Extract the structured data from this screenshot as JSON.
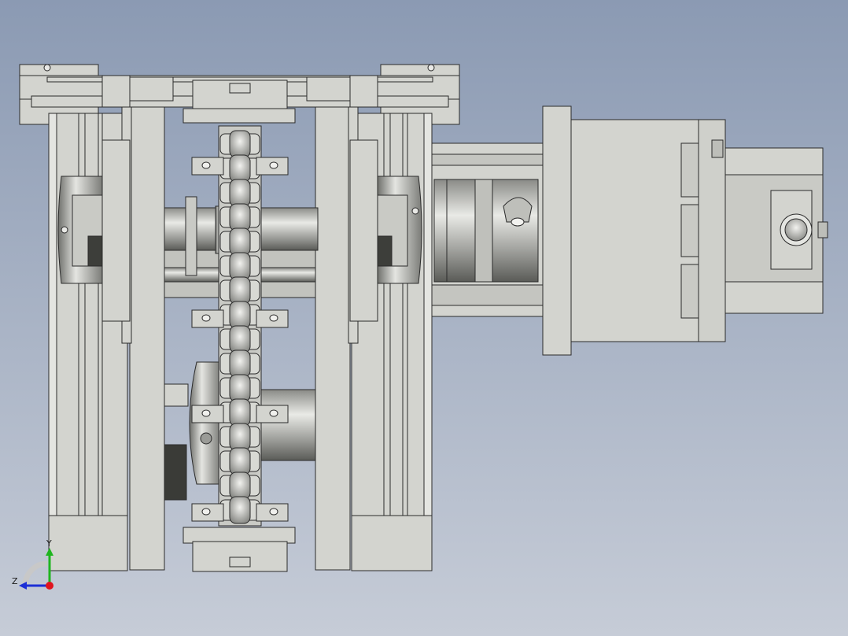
{
  "viewport": {
    "background_top": "#8b9ab3",
    "background_bottom": "#c6ccd7"
  },
  "model": {
    "part_fill": "#d3d4cf",
    "part_edge": "#2b2b2b",
    "shaded_dark": "#5f605c",
    "components": [
      "frame",
      "chain",
      "sprockets",
      "shaft",
      "coupling",
      "gearbox",
      "motor"
    ]
  },
  "triad": {
    "y_label": "Y",
    "z_label": "Z",
    "x_color": "#e0141e",
    "y_color": "#1fb51f",
    "z_color": "#1c2fd6"
  }
}
